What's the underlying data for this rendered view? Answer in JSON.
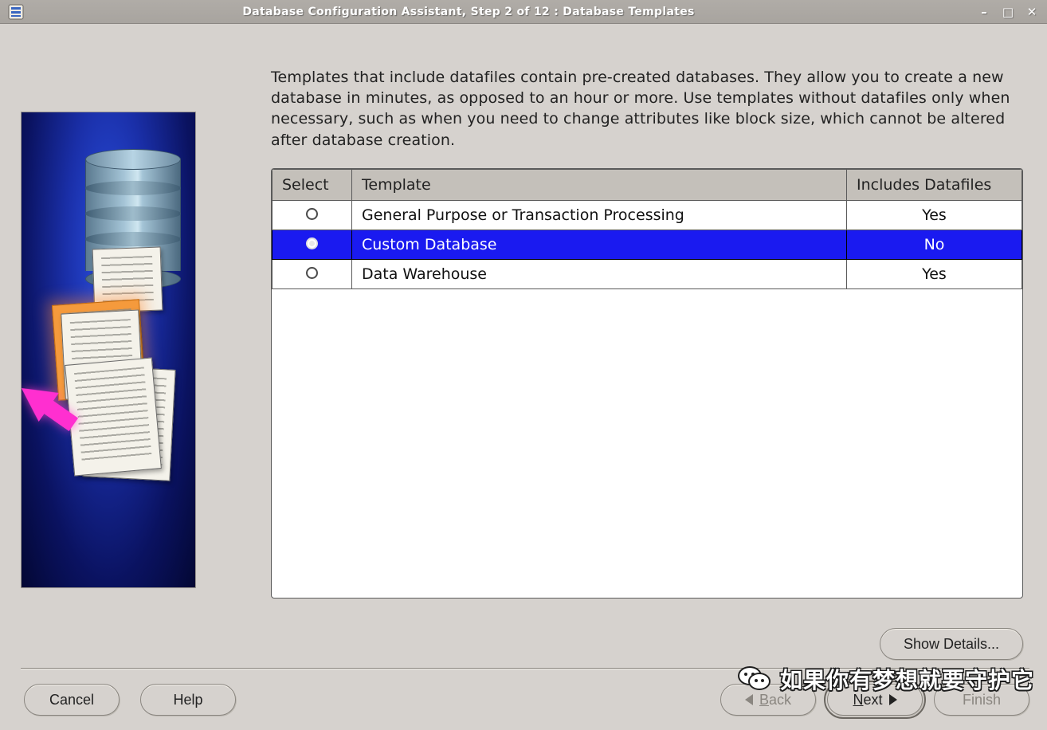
{
  "window": {
    "title": "Database Configuration Assistant, Step 2 of 12 : Database Templates"
  },
  "description": "Templates that include datafiles contain pre-created databases. They allow you to create a new database in minutes, as opposed to an hour or more. Use templates without datafiles only when necessary, such as when you need to change attributes like block size, which cannot be altered after database creation.",
  "table": {
    "headers": {
      "select": "Select",
      "template": "Template",
      "includes": "Includes Datafiles"
    },
    "rows": [
      {
        "template": "General Purpose or Transaction Processing",
        "includes": "Yes",
        "selected": false
      },
      {
        "template": "Custom Database",
        "includes": "No",
        "selected": true
      },
      {
        "template": "Data Warehouse",
        "includes": "Yes",
        "selected": false
      }
    ]
  },
  "buttons": {
    "show_details": "Show Details...",
    "cancel": "Cancel",
    "help": "Help",
    "back": "Back",
    "next": "Next",
    "finish": "Finish"
  },
  "watermark": "如果你有梦想就要守护它"
}
